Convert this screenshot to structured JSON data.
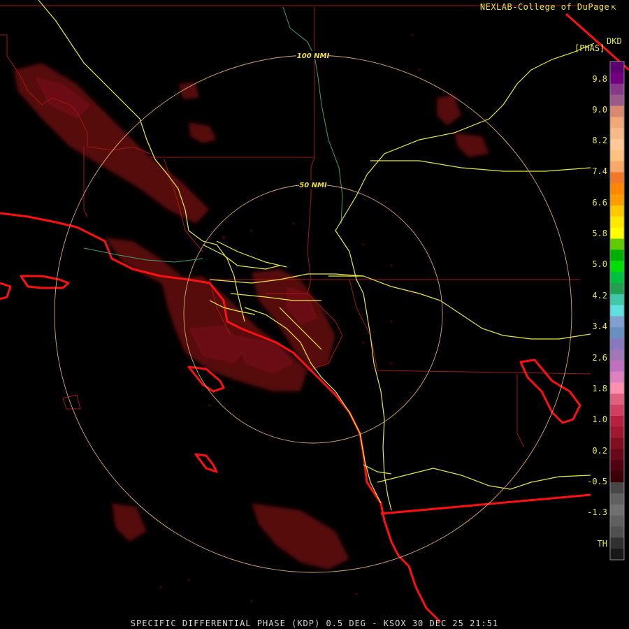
{
  "header": {
    "credit": "NEXLAB-College of DuPage",
    "credit_icon": "external-link-icon"
  },
  "legend": {
    "product_code": "DKD",
    "units": "[PHAS]",
    "ticks": [
      "9.8",
      "9.0",
      "8.2",
      "7.4",
      "6.6",
      "5.8",
      "5.0",
      "4.2",
      "3.4",
      "2.6",
      "1.8",
      "1.0",
      "0.2",
      "-0.5",
      "-1.3",
      "TH"
    ],
    "color_scale": [
      "#5a0070",
      "#700080",
      "#883888",
      "#9a5a8a",
      "#d88a70",
      "#f0a878",
      "#f8b888",
      "#ffc898",
      "#ffc080",
      "#f8a868",
      "#f07828",
      "#ff8800",
      "#ff9c00",
      "#ffc800",
      "#ffe800",
      "#ffff00",
      "#60cc00",
      "#00b000",
      "#00e000",
      "#00c040",
      "#20a050",
      "#40c8a8",
      "#60e0e0",
      "#80a0d0",
      "#6890c0",
      "#8878c0",
      "#a078b8",
      "#c070c0",
      "#e080c0",
      "#ff90b0",
      "#e06080",
      "#d04060",
      "#b82040",
      "#a01830",
      "#801020",
      "#680818",
      "#500010",
      "#3a0008",
      "#484848",
      "#606060",
      "#707070",
      "#606060",
      "#505050",
      "#303030",
      "#181818"
    ]
  },
  "range_rings": [
    {
      "label": "100 NMI"
    },
    {
      "label": "50 NMI"
    }
  ],
  "status_line": "SPECIFIC DIFFERENTIAL PHASE (KDP) 0.5 DEG - KSOX 30 DEC 25 21:51",
  "colors": {
    "ring": "#d8a878",
    "county_border": "#a01818",
    "state_border": "#ff1010",
    "highway": "#e8e840",
    "river": "#40a070",
    "echo_weak": "#5c0a10",
    "echo_medium": "#6e1018"
  }
}
